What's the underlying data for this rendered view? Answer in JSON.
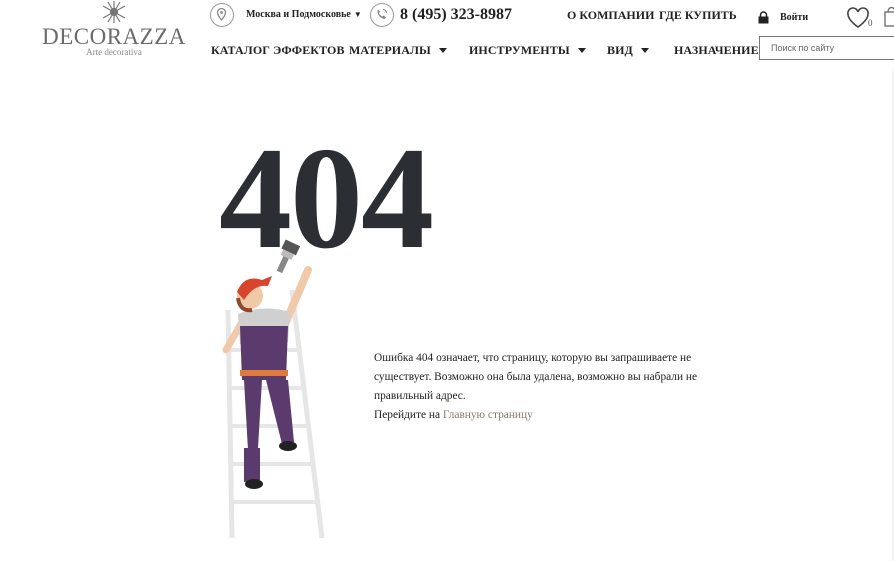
{
  "logo": {
    "name": "DECORAZZA",
    "tagline": "Arte decorativa"
  },
  "header": {
    "region": "Москва и Подмосковье",
    "phone": "8 (495) 323-8987",
    "links": [
      "О КОМПАНИИ",
      "ГДЕ КУПИТЬ"
    ],
    "login": "Войти",
    "wishlist_count": "0",
    "search_placeholder": "Поиск по сайту"
  },
  "nav": {
    "items": [
      {
        "label": "КАТАЛОГ ЭФФЕКТОВ",
        "dropdown": false
      },
      {
        "label": "МАТЕРИАЛЫ",
        "dropdown": true
      },
      {
        "label": "ИНСТРУМЕНТЫ",
        "dropdown": true
      },
      {
        "label": "ВИД",
        "dropdown": true
      },
      {
        "label": "НАЗНАЧЕНИЕ",
        "dropdown": false
      }
    ]
  },
  "error": {
    "code": "404",
    "message": "Ошибка 404 означает, что страницу, которую вы запрашиваете не существует. Возможно она была удалена, возможно вы набрали не правильный адрес.",
    "goto_prefix": "Перейдите на",
    "home_link": "Главную страницу"
  },
  "colors": {
    "heading": "#2b2f33",
    "link": "#8a7a6a",
    "worker_cap": "#d9452b",
    "worker_overalls": "#5b3a6e"
  },
  "icons": [
    "location-pin-icon",
    "phone-icon",
    "lock-icon",
    "heart-icon",
    "cart-icon",
    "caret-down-icon",
    "snowflake-logo-icon"
  ]
}
